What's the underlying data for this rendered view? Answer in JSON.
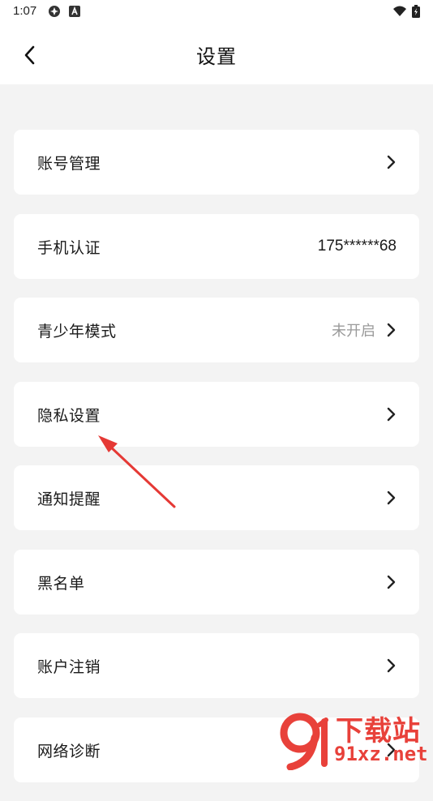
{
  "status_bar": {
    "time": "1:07"
  },
  "header": {
    "title": "设置"
  },
  "settings": [
    {
      "label": "账号管理",
      "value": "",
      "value_style": "none",
      "chevron": true
    },
    {
      "label": "手机认证",
      "value": "175******68",
      "value_style": "dark",
      "chevron": false
    },
    {
      "label": "青少年模式",
      "value": "未开启",
      "value_style": "muted",
      "chevron": true
    },
    {
      "label": "隐私设置",
      "value": "",
      "value_style": "none",
      "chevron": true
    },
    {
      "label": "通知提醒",
      "value": "",
      "value_style": "none",
      "chevron": true
    },
    {
      "label": "黑名单",
      "value": "",
      "value_style": "none",
      "chevron": true
    },
    {
      "label": "账户注销",
      "value": "",
      "value_style": "none",
      "chevron": true
    },
    {
      "label": "网络诊断",
      "value": "",
      "value_style": "none",
      "chevron": true
    }
  ],
  "annotation": {
    "arrow_color": "#e53935",
    "points_to": "隐私设置"
  },
  "watermark": {
    "logo_text": "下载站",
    "url_text": "91xz.net",
    "color": "#e8413a"
  }
}
